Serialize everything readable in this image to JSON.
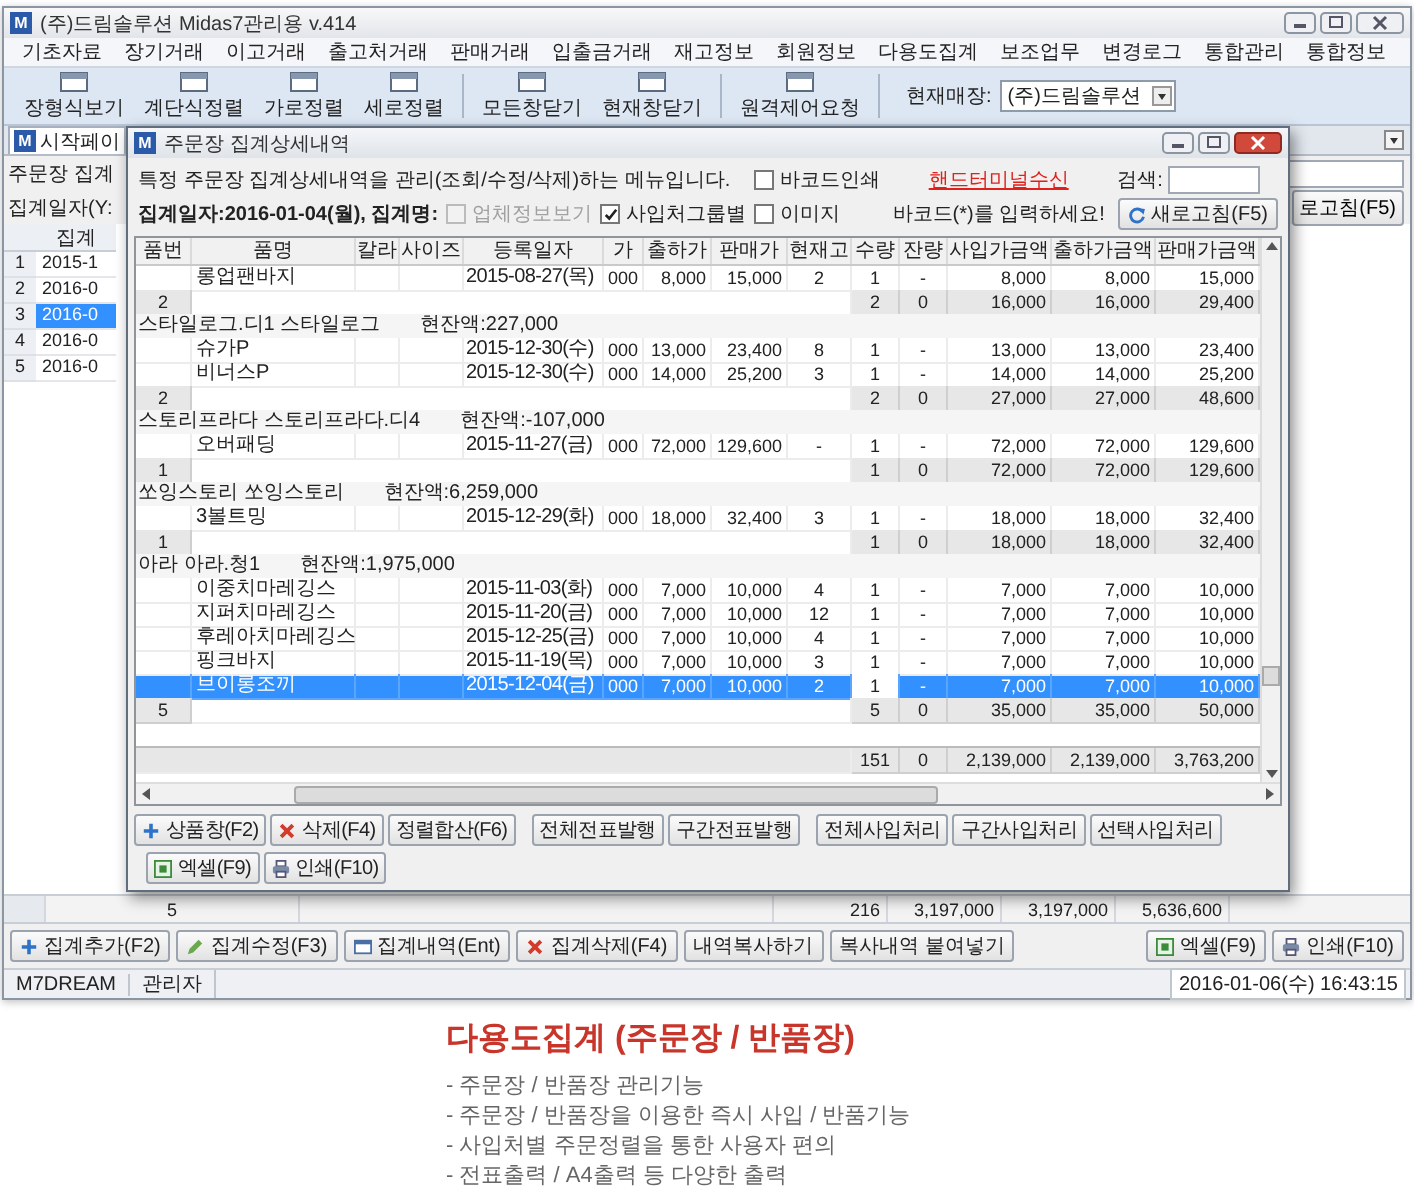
{
  "window": {
    "icon_letter": "M",
    "title": "(주)드림솔루션 Midas7관리용 v.414"
  },
  "menu": [
    "기초자료",
    "장기거래",
    "이고거래",
    "출고처거래",
    "판매거래",
    "입출금거래",
    "재고정보",
    "회원정보",
    "다용도집계",
    "보조업무",
    "변경로그",
    "통합관리",
    "통합정보"
  ],
  "toolbar": {
    "groups": [
      [
        "장형식보기",
        "계단식정렬",
        "가로정렬",
        "세로정렬"
      ],
      [
        "모든창닫기",
        "현재창닫기"
      ],
      [
        "원격제어요청"
      ]
    ],
    "store_label": "현재매장:",
    "store_value": "(주)드림솔루션"
  },
  "tabs": [
    {
      "icon_letter": "M",
      "label": "시작페이",
      "selected": true
    }
  ],
  "form": {
    "labels": [
      "주문장 집계",
      "집계일자(Y:"
    ],
    "refresh_button": "로고침(F5)",
    "grid_header": "집계",
    "rows": [
      {
        "number": "1",
        "date": "2015-1",
        "selected": false
      },
      {
        "number": "2",
        "date": "2016-0",
        "selected": false
      },
      {
        "number": "3",
        "date": "2016-0",
        "selected": true
      },
      {
        "number": "4",
        "date": "2016-0",
        "selected": false
      },
      {
        "number": "5",
        "date": "2016-0",
        "selected": false
      }
    ],
    "footer": {
      "count": "5",
      "qty": "216",
      "amounts": [
        "3,197,000",
        "3,197,000",
        "5,636,600"
      ]
    }
  },
  "dialog": {
    "icon_letter": "M",
    "title": "주문장 집계상세내역",
    "description": "특정 주문장 집계상세내역을 관리(조회/수정/삭제)하는 메뉴입니다.",
    "summary": "집계일자:2016-01-04(월), 집계명:",
    "checkboxes": [
      {
        "label": "바코드인쇄",
        "checked": false,
        "disabled": false
      },
      {
        "label": "업체정보보기",
        "checked": false,
        "disabled": true
      },
      {
        "label": "사입처그룹별",
        "checked": true,
        "disabled": false
      },
      {
        "label": "이미지",
        "checked": false,
        "disabled": false
      }
    ],
    "link": "핸드터미널수신",
    "search_label": "검색:",
    "barcode_hint": "바코드(*)를 입력하세요!",
    "refresh_button": "새로고침(F5)",
    "columns": [
      "품번",
      "품명",
      "칼라",
      "사이즈",
      "등록일자",
      "가",
      "출하가",
      "판매가",
      "현재고",
      "수량",
      "잔량",
      "사입가금액",
      "출하가금액",
      "판매가금액"
    ],
    "rows": [
      {
        "kind": "item",
        "selected": false,
        "name": "롱업팬바지",
        "date": "2015-08-27(목)",
        "column_6": "000",
        "ship_price": "8,000",
        "sale_price": "15,000",
        "stock": "2",
        "qty": "1",
        "remain": "-",
        "cost_amount": "8,000",
        "ship_amount": "8,000",
        "sale_amount": "15,000"
      },
      {
        "kind": "subtotal",
        "count": "2",
        "qty": "2",
        "remain": "0",
        "cost_amount": "16,000",
        "ship_amount": "16,000",
        "sale_amount": "29,400"
      },
      {
        "kind": "group",
        "name": "스타일로그.디1 스타일로그",
        "balance": "현잔액:227,000"
      },
      {
        "kind": "item",
        "selected": false,
        "name": "슈가P",
        "date": "2015-12-30(수)",
        "column_6": "000",
        "ship_price": "13,000",
        "sale_price": "23,400",
        "stock": "8",
        "qty": "1",
        "remain": "-",
        "cost_amount": "13,000",
        "ship_amount": "13,000",
        "sale_amount": "23,400"
      },
      {
        "kind": "item",
        "selected": false,
        "name": "비너스P",
        "date": "2015-12-30(수)",
        "column_6": "000",
        "ship_price": "14,000",
        "sale_price": "25,200",
        "stock": "3",
        "qty": "1",
        "remain": "-",
        "cost_amount": "14,000",
        "ship_amount": "14,000",
        "sale_amount": "25,200"
      },
      {
        "kind": "subtotal",
        "count": "2",
        "qty": "2",
        "remain": "0",
        "cost_amount": "27,000",
        "ship_amount": "27,000",
        "sale_amount": "48,600"
      },
      {
        "kind": "group",
        "name": "스토리프라다 스토리프라다.디4",
        "balance": "현잔액:-107,000"
      },
      {
        "kind": "item",
        "selected": false,
        "name": "오버패딩",
        "date": "2015-11-27(금)",
        "column_6": "000",
        "ship_price": "72,000",
        "sale_price": "129,600",
        "stock": "-",
        "qty": "1",
        "remain": "-",
        "cost_amount": "72,000",
        "ship_amount": "72,000",
        "sale_amount": "129,600"
      },
      {
        "kind": "subtotal",
        "count": "1",
        "qty": "1",
        "remain": "0",
        "cost_amount": "72,000",
        "ship_amount": "72,000",
        "sale_amount": "129,600"
      },
      {
        "kind": "group",
        "name": "쏘잉스토리 쏘잉스토리",
        "balance": "현잔액:6,259,000"
      },
      {
        "kind": "item",
        "selected": false,
        "name": "3볼트밍",
        "date": "2015-12-29(화)",
        "column_6": "000",
        "ship_price": "18,000",
        "sale_price": "32,400",
        "stock": "3",
        "qty": "1",
        "remain": "-",
        "cost_amount": "18,000",
        "ship_amount": "18,000",
        "sale_amount": "32,400"
      },
      {
        "kind": "subtotal",
        "count": "1",
        "qty": "1",
        "remain": "0",
        "cost_amount": "18,000",
        "ship_amount": "18,000",
        "sale_amount": "32,400"
      },
      {
        "kind": "group",
        "name": "아라 아라.청1",
        "balance": "현잔액:1,975,000"
      },
      {
        "kind": "item",
        "selected": false,
        "name": "이중치마레깅스",
        "date": "2015-11-03(화)",
        "column_6": "000",
        "ship_price": "7,000",
        "sale_price": "10,000",
        "stock": "4",
        "qty": "1",
        "remain": "-",
        "cost_amount": "7,000",
        "ship_amount": "7,000",
        "sale_amount": "10,000"
      },
      {
        "kind": "item",
        "selected": false,
        "name": "지퍼치마레깅스",
        "date": "2015-11-20(금)",
        "column_6": "000",
        "ship_price": "7,000",
        "sale_price": "10,000",
        "stock": "12",
        "qty": "1",
        "remain": "-",
        "cost_amount": "7,000",
        "ship_amount": "7,000",
        "sale_amount": "10,000"
      },
      {
        "kind": "item",
        "selected": false,
        "name": "후레아치마레깅스",
        "date": "2015-12-25(금)",
        "column_6": "000",
        "ship_price": "7,000",
        "sale_price": "10,000",
        "stock": "4",
        "qty": "1",
        "remain": "-",
        "cost_amount": "7,000",
        "ship_amount": "7,000",
        "sale_amount": "10,000"
      },
      {
        "kind": "item",
        "selected": false,
        "name": "핑크바지",
        "date": "2015-11-19(목)",
        "column_6": "000",
        "ship_price": "7,000",
        "sale_price": "10,000",
        "stock": "3",
        "qty": "1",
        "remain": "-",
        "cost_amount": "7,000",
        "ship_amount": "7,000",
        "sale_amount": "10,000"
      },
      {
        "kind": "item",
        "selected": true,
        "name": "브이롱조끼",
        "date": "2015-12-04(금)",
        "column_6": "000",
        "ship_price": "7,000",
        "sale_price": "10,000",
        "stock": "2",
        "qty": "1",
        "remain": "-",
        "cost_amount": "7,000",
        "ship_amount": "7,000",
        "sale_amount": "10,000"
      },
      {
        "kind": "subtotal",
        "count": "5",
        "qty": "5",
        "remain": "0",
        "cost_amount": "35,000",
        "ship_amount": "35,000",
        "sale_amount": "50,000"
      },
      {
        "kind": "total",
        "qty": "151",
        "remain": "0",
        "cost_amount": "2,139,000",
        "ship_amount": "2,139,000",
        "sale_amount": "3,763,200"
      }
    ],
    "button_groups": [
      [
        {
          "label": "상품창(F2)",
          "kind": "add"
        },
        {
          "label": "삭제(F4)",
          "kind": "delete"
        },
        {
          "label": "정렬합산(F6)",
          "kind": "plain"
        }
      ],
      [
        {
          "label": "전체전표발행",
          "kind": "plain"
        },
        {
          "label": "구간전표발행",
          "kind": "plain"
        }
      ],
      [
        {
          "label": "전체사입처리",
          "kind": "plain"
        },
        {
          "label": "구간사입처리",
          "kind": "plain"
        },
        {
          "label": "선택사입처리",
          "kind": "plain"
        }
      ],
      [
        {
          "label": "엑셀(F9)",
          "kind": "excel"
        },
        {
          "label": "인쇄(F10)",
          "kind": "print"
        }
      ]
    ]
  },
  "buttons": [
    {
      "label": "집계추가(F2)",
      "kind": "add"
    },
    {
      "label": "집계수정(F3)",
      "kind": "edit"
    },
    {
      "label": "집계내역(Ent)",
      "kind": "list"
    },
    {
      "label": "집계삭제(F4)",
      "kind": "delete"
    },
    {
      "label": "내역복사하기",
      "kind": "plain"
    },
    {
      "label": "복사내역 붙여넣기",
      "kind": "plain"
    }
  ],
  "right_buttons": [
    {
      "label": "엑셀(F9)",
      "kind": "excel"
    },
    {
      "label": "인쇄(F10)",
      "kind": "print"
    }
  ],
  "status_bar": {
    "items": [
      "M7DREAM",
      "관리자"
    ],
    "datetime": "2016-01-06(수) 16:43:15"
  },
  "caption": {
    "title": "다용도집계 (주문장 / 반품장)",
    "bullets": [
      "- 주문장 / 반품장 관리기능",
      "- 주문장 / 반품장을 이용한 즉시 사입 / 반품기능",
      "- 사입처별 주문정렬을 통한 사용자 편의",
      "- 전표출력 / A4출력 등 다양한 출력"
    ]
  }
}
